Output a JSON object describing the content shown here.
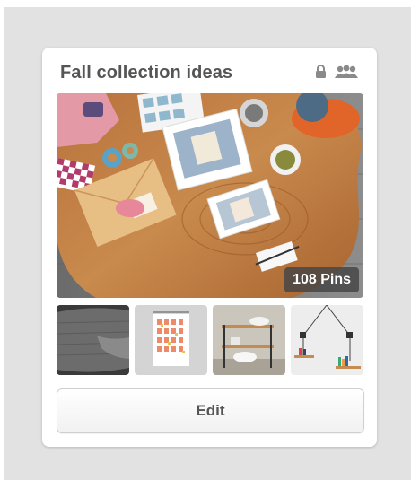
{
  "board": {
    "title": "Fall collection ideas",
    "pins_count": "108 Pins",
    "edit_label": "Edit",
    "status_icons": [
      "lock-icon",
      "collaborators-icon"
    ]
  },
  "thumbnails": [
    "gray-blanket",
    "pattern-print-poster",
    "shelf-with-bowls",
    "hanging-rope-shelves"
  ],
  "colors": {
    "background": "#e2e2e2",
    "card": "#ffffff",
    "title_text": "#555555",
    "badge_bg": "#464646"
  }
}
